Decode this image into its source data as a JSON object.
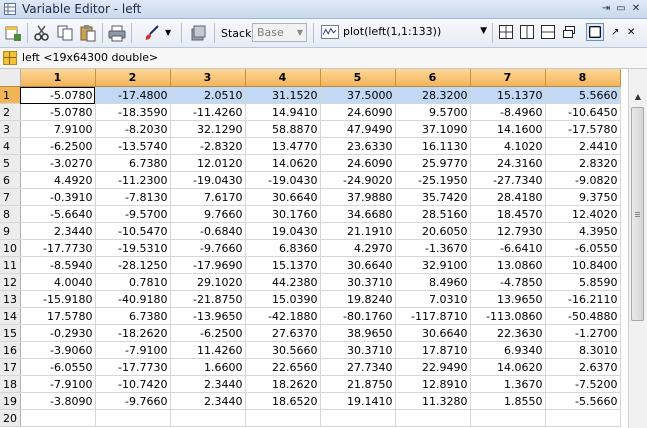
{
  "window": {
    "title": "Variable Editor - left",
    "title_icon": "variable-editor-icon",
    "controls": [
      "undock-icon",
      "minimize-icon",
      "close-icon"
    ]
  },
  "toolbar": {
    "stack_label": "Stack:",
    "stack_value": "Base",
    "plot_value": "plot(left(1,1:133))"
  },
  "variable": {
    "description": "left <19x64300 double>"
  },
  "grid": {
    "column_headers": [
      "1",
      "2",
      "3",
      "4",
      "5",
      "6",
      "7",
      "8"
    ],
    "rows": [
      {
        "index": "1",
        "values": [
          "-5.0780",
          "-17.4800",
          "2.0510",
          "31.1520",
          "37.5000",
          "28.3200",
          "15.1370",
          "5.5660"
        ]
      },
      {
        "index": "2",
        "values": [
          "-5.0780",
          "-18.3590",
          "-11.4260",
          "14.9410",
          "24.6090",
          "9.5700",
          "-8.4960",
          "-10.6450"
        ]
      },
      {
        "index": "3",
        "values": [
          "7.9100",
          "-8.2030",
          "32.1290",
          "58.8870",
          "47.9490",
          "37.1090",
          "14.1600",
          "-17.5780"
        ]
      },
      {
        "index": "4",
        "values": [
          "-6.2500",
          "-13.5740",
          "-2.8320",
          "13.4770",
          "23.6330",
          "16.1130",
          "4.1020",
          "2.4410"
        ]
      },
      {
        "index": "5",
        "values": [
          "-3.0270",
          "6.7380",
          "12.0120",
          "14.0620",
          "24.6090",
          "25.9770",
          "24.3160",
          "2.8320"
        ]
      },
      {
        "index": "6",
        "values": [
          "4.4920",
          "-11.2300",
          "-19.0430",
          "-19.0430",
          "-24.9020",
          "-25.1950",
          "-27.7340",
          "-9.0820"
        ]
      },
      {
        "index": "7",
        "values": [
          "-0.3910",
          "-7.8130",
          "7.6170",
          "30.6640",
          "37.9880",
          "35.7420",
          "28.4180",
          "9.3750"
        ]
      },
      {
        "index": "8",
        "values": [
          "-5.6640",
          "-9.5700",
          "9.7660",
          "30.1760",
          "34.6680",
          "28.5160",
          "18.4570",
          "12.4020"
        ]
      },
      {
        "index": "9",
        "values": [
          "2.3440",
          "-10.5470",
          "-0.6840",
          "19.0430",
          "21.1910",
          "20.6050",
          "12.7930",
          "4.3950"
        ]
      },
      {
        "index": "10",
        "values": [
          "-17.7730",
          "-19.5310",
          "-9.7660",
          "6.8360",
          "4.2970",
          "-1.3670",
          "-6.6410",
          "-6.0550"
        ]
      },
      {
        "index": "11",
        "values": [
          "-8.5940",
          "-28.1250",
          "-17.9690",
          "15.1370",
          "30.6640",
          "32.9100",
          "13.0860",
          "10.8400"
        ]
      },
      {
        "index": "12",
        "values": [
          "4.0040",
          "0.7810",
          "29.1020",
          "44.2380",
          "30.3710",
          "8.4960",
          "-4.7850",
          "5.8590"
        ]
      },
      {
        "index": "13",
        "values": [
          "-15.9180",
          "-40.9180",
          "-21.8750",
          "15.0390",
          "19.8240",
          "7.0310",
          "13.9650",
          "-16.2110"
        ]
      },
      {
        "index": "14",
        "values": [
          "17.5780",
          "6.7380",
          "-13.9650",
          "-42.1880",
          "-80.1760",
          "-117.8710",
          "-113.0860",
          "-50.4880"
        ]
      },
      {
        "index": "15",
        "values": [
          "-0.2930",
          "-18.2620",
          "-6.2500",
          "27.6370",
          "38.9650",
          "30.6640",
          "22.3630",
          "-1.2700"
        ]
      },
      {
        "index": "16",
        "values": [
          "-3.9060",
          "-7.9100",
          "11.4260",
          "30.5660",
          "30.3710",
          "17.8710",
          "6.9340",
          "8.3010"
        ]
      },
      {
        "index": "17",
        "values": [
          "-6.0550",
          "-17.7730",
          "1.6600",
          "22.6560",
          "27.7340",
          "22.9490",
          "14.0620",
          "2.6370"
        ]
      },
      {
        "index": "18",
        "values": [
          "-7.9100",
          "-10.7420",
          "2.3440",
          "18.2620",
          "21.8750",
          "12.8910",
          "1.3670",
          "-7.5200"
        ]
      },
      {
        "index": "19",
        "values": [
          "-3.8090",
          "-9.7660",
          "2.3440",
          "18.6520",
          "19.1410",
          "11.3280",
          "1.8550",
          "-5.5660"
        ]
      },
      {
        "index": "20",
        "values": [
          "",
          "",
          "",
          "",
          "",
          "",
          "",
          ""
        ]
      }
    ],
    "selected_row": "1"
  },
  "colors": {
    "header_orange": "#f3b45c",
    "selection_blue": "#c2d9f5",
    "titlebar_blue": "#c9d9ee"
  }
}
